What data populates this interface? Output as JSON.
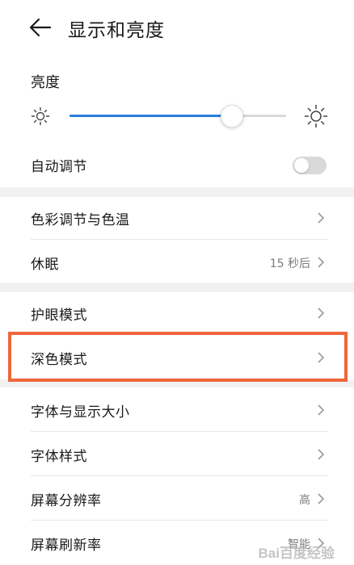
{
  "header": {
    "title": "显示和亮度",
    "back_icon": "back-arrow-icon"
  },
  "brightness": {
    "label": "亮度",
    "level": 0.75,
    "icon_low": "sun-small-icon",
    "icon_high": "sun-large-icon"
  },
  "auto_adjust": {
    "label": "自动调节",
    "enabled": false
  },
  "items": [
    {
      "label": "色彩调节与色温",
      "value": ""
    },
    {
      "label": "休眠",
      "value": "15 秒后"
    },
    {
      "label": "护眼模式",
      "value": ""
    },
    {
      "label": "深色模式",
      "value": ""
    },
    {
      "label": "字体与显示大小",
      "value": ""
    },
    {
      "label": "字体样式",
      "value": ""
    },
    {
      "label": "屏幕分辨率",
      "value": "高"
    },
    {
      "label": "屏幕刷新率",
      "value": "智能"
    }
  ],
  "colors": {
    "accent": "#2b7de0",
    "highlight": "#f0663a"
  },
  "watermark": {
    "text": "Bai百度经验"
  }
}
